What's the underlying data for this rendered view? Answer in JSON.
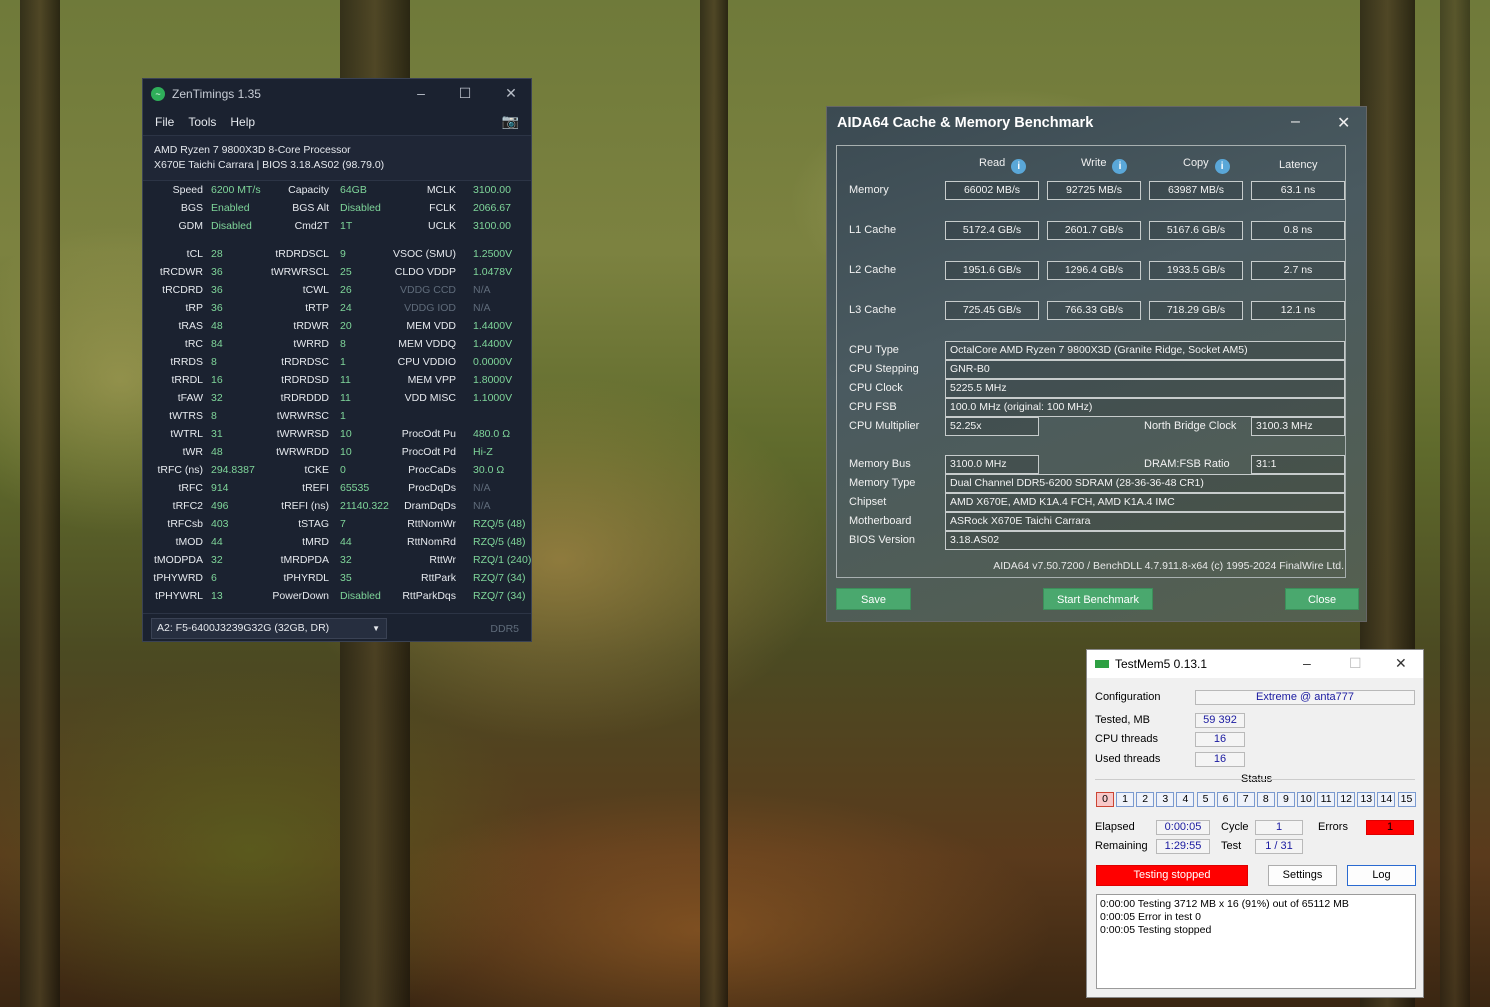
{
  "zentimings": {
    "title": "ZenTimings 1.35",
    "menu": [
      "File",
      "Tools",
      "Help"
    ],
    "cpu": "AMD Ryzen 7 9800X3D 8-Core Processor",
    "board": "X670E Taichi Carrara | BIOS 3.18.AS02 (98.79.0)",
    "top": [
      [
        "Speed",
        "6200 MT/s",
        "Capacity",
        "64GB",
        "MCLK",
        "3100.00"
      ],
      [
        "BGS",
        "Enabled",
        "BGS Alt",
        "Disabled",
        "FCLK",
        "2066.67"
      ],
      [
        "GDM",
        "Disabled",
        "Cmd2T",
        "1T",
        "UCLK",
        "3100.00"
      ]
    ],
    "rows": [
      [
        "tCL",
        "28",
        "tRDRDSCL",
        "9",
        "VSOC (SMU)",
        "1.2500V"
      ],
      [
        "tRCDWR",
        "36",
        "tWRWRSCL",
        "25",
        "CLDO VDDP",
        "1.0478V"
      ],
      [
        "tRCDRD",
        "36",
        "tCWL",
        "26",
        "VDDG CCD",
        "N/A"
      ],
      [
        "tRP",
        "36",
        "tRTP",
        "24",
        "VDDG IOD",
        "N/A"
      ],
      [
        "tRAS",
        "48",
        "tRDWR",
        "20",
        "MEM VDD",
        "1.4400V"
      ],
      [
        "tRC",
        "84",
        "tWRRD",
        "8",
        "MEM VDDQ",
        "1.4400V"
      ],
      [
        "tRRDS",
        "8",
        "tRDRDSC",
        "1",
        "CPU VDDIO",
        "0.0000V"
      ],
      [
        "tRRDL",
        "16",
        "tRDRDSD",
        "11",
        "MEM VPP",
        "1.8000V"
      ],
      [
        "tFAW",
        "32",
        "tRDRDDD",
        "11",
        "VDD MISC",
        "1.1000V"
      ],
      [
        "tWTRS",
        "8",
        "tWRWRSC",
        "1",
        "",
        ""
      ],
      [
        "tWTRL",
        "31",
        "tWRWRSD",
        "10",
        "ProcOdt Pu",
        "480.0 Ω"
      ],
      [
        "tWR",
        "48",
        "tWRWRDD",
        "10",
        "ProcOdt Pd",
        "Hi-Z"
      ],
      [
        "tRFC (ns)",
        "294.8387",
        "tCKE",
        "0",
        "ProcCaDs",
        "30.0 Ω"
      ],
      [
        "tRFC",
        "914",
        "tREFI",
        "65535",
        "ProcDqDs",
        "N/A"
      ],
      [
        "tRFC2",
        "496",
        "tREFI (ns)",
        "21140.322",
        "DramDqDs",
        "N/A"
      ],
      [
        "tRFCsb",
        "403",
        "tSTAG",
        "7",
        "RttNomWr",
        "RZQ/5 (48)"
      ],
      [
        "tMOD",
        "44",
        "tMRD",
        "44",
        "RttNomRd",
        "RZQ/5 (48)"
      ],
      [
        "tMODPDA",
        "32",
        "tMRDPDA",
        "32",
        "RttWr",
        "RZQ/1 (240)"
      ],
      [
        "tPHYWRD",
        "6",
        "tPHYRDL",
        "35",
        "RttPark",
        "RZQ/7 (34)"
      ],
      [
        "tPHYWRL",
        "13",
        "PowerDown",
        "Disabled",
        "RttParkDqs",
        "RZQ/7 (34)"
      ]
    ],
    "dimm": "A2: F5-6400J3239G32G (32GB, DR)",
    "ddr": "DDR5"
  },
  "aida": {
    "title": "AIDA64 Cache & Memory Benchmark",
    "headers": [
      "Read",
      "Write",
      "Copy",
      "Latency"
    ],
    "bench": [
      {
        "label": "Memory",
        "vals": [
          "66002 MB/s",
          "92725 MB/s",
          "63987 MB/s",
          "63.1 ns"
        ]
      },
      {
        "label": "L1 Cache",
        "vals": [
          "5172.4 GB/s",
          "2601.7 GB/s",
          "5167.6 GB/s",
          "0.8 ns"
        ]
      },
      {
        "label": "L2 Cache",
        "vals": [
          "1951.6 GB/s",
          "1296.4 GB/s",
          "1933.5 GB/s",
          "2.7 ns"
        ]
      },
      {
        "label": "L3 Cache",
        "vals": [
          "725.45 GB/s",
          "766.33 GB/s",
          "718.29 GB/s",
          "12.1 ns"
        ]
      }
    ],
    "cpu_type_label": "CPU Type",
    "cpu_type": "OctalCore AMD Ryzen 7 9800X3D  (Granite Ridge, Socket AM5)",
    "cpu_stepping_label": "CPU Stepping",
    "cpu_stepping": "GNR-B0",
    "cpu_clock_label": "CPU Clock",
    "cpu_clock": "5225.5 MHz",
    "cpu_fsb_label": "CPU FSB",
    "cpu_fsb": "100.0 MHz  (original: 100 MHz)",
    "cpu_mult_label": "CPU Multiplier",
    "cpu_mult": "52.25x",
    "nb_clock_label": "North Bridge Clock",
    "nb_clock": "3100.3 MHz",
    "mem_bus_label": "Memory Bus",
    "mem_bus": "3100.0 MHz",
    "dram_fsb_label": "DRAM:FSB Ratio",
    "dram_fsb": "31:1",
    "mem_type_label": "Memory Type",
    "mem_type": "Dual Channel DDR5-6200 SDRAM  (28-36-36-48 CR1)",
    "chipset_label": "Chipset",
    "chipset": "AMD X670E, AMD K1A.4 FCH, AMD K1A.4 IMC",
    "mobo_label": "Motherboard",
    "mobo": "ASRock X670E Taichi Carrara",
    "bios_label": "BIOS Version",
    "bios": "3.18.AS02",
    "version": "AIDA64 v7.50.7200 / BenchDLL 4.7.911.8-x64  (c) 1995-2024 FinalWire Ltd.",
    "save": "Save",
    "start": "Start Benchmark",
    "close": "Close"
  },
  "testmem": {
    "title": "TestMem5  0.13.1",
    "config_label": "Configuration",
    "config": "Extreme @ anta777",
    "tested_label": "Tested, MB",
    "tested": "59 392",
    "cpu_threads_label": "CPU threads",
    "cpu_threads": "16",
    "used_threads_label": "Used threads",
    "used_threads": "16",
    "status_label": "Status",
    "threads": [
      "0",
      "1",
      "2",
      "3",
      "4",
      "5",
      "6",
      "7",
      "8",
      "9",
      "10",
      "11",
      "12",
      "13",
      "14",
      "15"
    ],
    "elapsed_label": "Elapsed",
    "elapsed": "0:00:05",
    "remaining_label": "Remaining",
    "remaining": "1:29:55",
    "cycle_label": "Cycle",
    "cycle": "1",
    "test_label": "Test",
    "test": "1 / 31",
    "errors_label": "Errors",
    "errors": "1",
    "stopped": "Testing stopped",
    "settings": "Settings",
    "log": "Log",
    "log_lines": [
      "0:00:00  Testing 3712 MB x 16 (91%) out of 65112 MB",
      "0:00:05  Error in test 0",
      "0:00:05  Testing stopped"
    ],
    "colors": {
      "error": "#ff0000",
      "accent": "#1a1aa0"
    }
  }
}
